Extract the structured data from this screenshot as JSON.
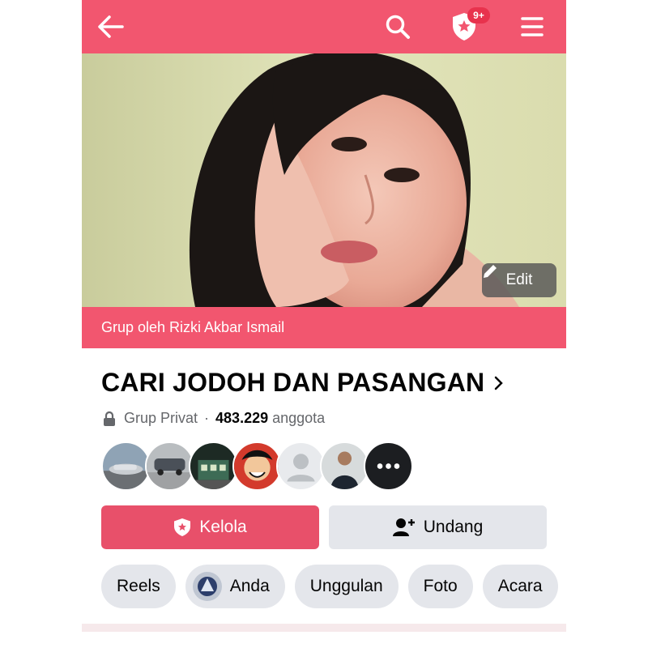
{
  "header": {
    "badge": "9+",
    "accent_color": "#f2566f"
  },
  "cover": {
    "edit_label": "Edit",
    "byline": "Grup oleh Rizki Akbar Ismail"
  },
  "group": {
    "title": "CARI JODOH DAN PASANGAN",
    "privacy": "Grup Privat",
    "separator": "·",
    "member_count": "483.229",
    "member_label": "anggota"
  },
  "members": [
    {
      "name": "car-photo"
    },
    {
      "name": "car-road-photo"
    },
    {
      "name": "building-night-photo"
    },
    {
      "name": "anime-character"
    },
    {
      "name": "default-avatar"
    },
    {
      "name": "man-jacket-photo"
    },
    {
      "name": "more"
    }
  ],
  "actions": {
    "manage_label": "Kelola",
    "invite_label": "Undang",
    "primary_color": "#e8506a"
  },
  "tabs": [
    {
      "label": "Reels"
    },
    {
      "label": "Anda"
    },
    {
      "label": "Unggulan"
    },
    {
      "label": "Foto"
    },
    {
      "label": "Acara"
    }
  ]
}
